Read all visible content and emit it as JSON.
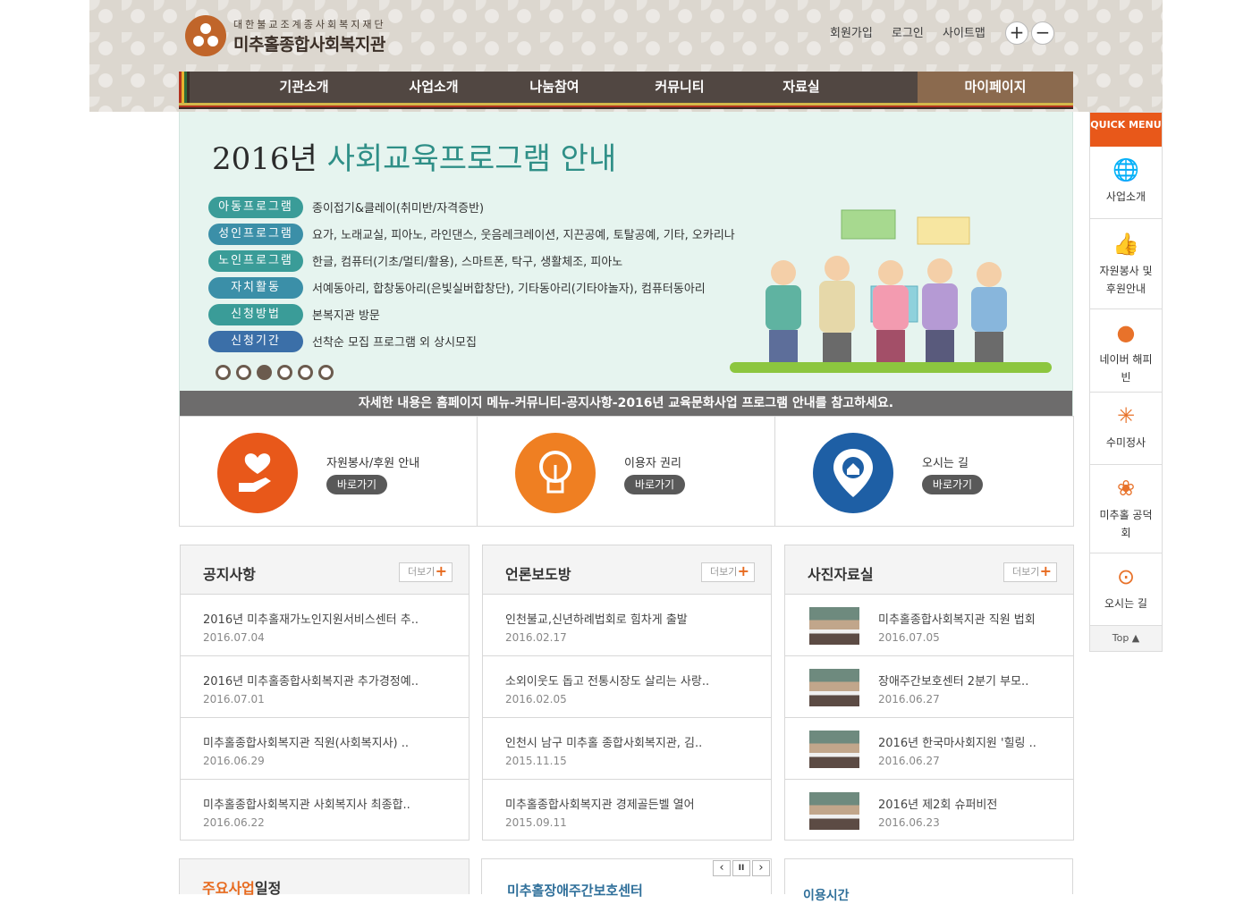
{
  "header": {
    "org_small": "대한불교조계종사회복지재단",
    "org_name": "미추홀종합사회복지관",
    "util": [
      "회원가입",
      "로그인",
      "사이트맵"
    ],
    "zoom_in": "+",
    "zoom_out": "−"
  },
  "nav": [
    "기관소개",
    "사업소개",
    "나눔참여",
    "커뮤니티",
    "자료실",
    "마이페이지"
  ],
  "banner": {
    "title_year": "2016년",
    "title_main": "사회교육프로그램 안내",
    "rows": [
      {
        "tag": "아동프로그램",
        "text": "종이접기&클레이(취미반/자격증반)",
        "color": "#3a9c98"
      },
      {
        "tag": "성인프로그램",
        "text": "요가, 노래교실, 피아노, 라인댄스, 웃음레크레이션, 지끈공예, 토탈공예, 기타, 오카리나",
        "color": "#3b8fa8"
      },
      {
        "tag": "노인프로그램",
        "text": "한글, 컴퓨터(기초/멀티/활용), 스마트폰, 탁구, 생활체조, 피아노",
        "color": "#3a9c98"
      },
      {
        "tag": "자치활동",
        "text": "서예동아리, 합창동아리(은빛실버합창단), 기타동아리(기타야놀자), 컴퓨터동아리",
        "color": "#3b8fa8"
      },
      {
        "tag": "신청방법",
        "text": "본복지관 방문",
        "color": "#3a9c98"
      },
      {
        "tag": "신청기간",
        "text": "선착순 모집 프로그램 외 상시모집",
        "color": "#3b6fa8"
      }
    ],
    "active_slide": 3,
    "slide_count": 6,
    "note": "자세한 내용은 홈페이지 메뉴-커뮤니티-공지사항-2016년 교육문화사업 프로그램 안내를 참고하세요."
  },
  "quick": [
    {
      "label": "자원봉사/후원 안내",
      "button": "바로가기",
      "color": "#e8581a",
      "icon": "heart-hand-icon"
    },
    {
      "label": "이용자 권리",
      "button": "바로가기",
      "color": "#ef7f22",
      "icon": "lightbulb-icon"
    },
    {
      "label": "오시는 길",
      "button": "바로가기",
      "color": "#1e5fa5",
      "icon": "map-pin-home-icon"
    }
  ],
  "boards": [
    {
      "title": "공지사항",
      "more": "더보기",
      "photo": false,
      "items": [
        {
          "title": "2016년 미추홀재가노인지원서비스센터 추..",
          "date": "2016.07.04"
        },
        {
          "title": "2016년 미추홀종합사회복지관 추가경정예..",
          "date": "2016.07.01"
        },
        {
          "title": "미추홀종합사회복지관 직원(사회복지사) ..",
          "date": "2016.06.29"
        },
        {
          "title": "미추홀종합사회복지관 사회복지사 최종합..",
          "date": "2016.06.22"
        }
      ]
    },
    {
      "title": "언론보도방",
      "more": "더보기",
      "photo": false,
      "items": [
        {
          "title": "인천불교,신년하례법회로 힘차게 출발",
          "date": "2016.02.17"
        },
        {
          "title": "소외이웃도 돕고 전통시장도 살리는 사랑..",
          "date": "2016.02.05"
        },
        {
          "title": "인천시 남구 미추홀 종합사회복지관, 김..",
          "date": "2015.11.15"
        },
        {
          "title": "미추홀종합사회복지관 경제골든벨 열어",
          "date": "2015.09.11"
        }
      ]
    },
    {
      "title": "사진자료실",
      "more": "더보기",
      "photo": true,
      "items": [
        {
          "title": "미추홀종합사회복지관 직원 법회",
          "date": "2016.07.05"
        },
        {
          "title": "장애주간보호센터 2분기 부모..",
          "date": "2016.06.27"
        },
        {
          "title": "2016년 한국마사회지원 '힐링 ..",
          "date": "2016.06.27"
        },
        {
          "title": "2016년 제2회 슈퍼비전",
          "date": "2016.06.23"
        }
      ]
    }
  ],
  "quickmenu": {
    "head": "QUICK MENU",
    "items": [
      {
        "label": "사업소개",
        "icon": "globe-icon",
        "glyph": "🌐"
      },
      {
        "label": "자원봉사 및 후원안내",
        "icon": "thumbs-up-icon",
        "glyph": "👍"
      },
      {
        "label": "네이버 해피빈",
        "icon": "bean-icon",
        "glyph": "●"
      },
      {
        "label": "수미정사",
        "icon": "temple-icon",
        "glyph": "✳"
      },
      {
        "label": "미추홀 공덕회",
        "icon": "lotus-icon",
        "glyph": "❀"
      },
      {
        "label": "오시는 길",
        "icon": "location-pin-icon",
        "glyph": "⊙"
      }
    ],
    "top": "Top ▲"
  },
  "bottom": {
    "schedule_a": "주요사업",
    "schedule_b": "일정",
    "center": "미추홀장애주간보호센터",
    "hours": "이용시간",
    "prev": "‹",
    "pause": "II",
    "next": "›"
  },
  "colors": {
    "accent": "#e8581a",
    "nav_bg": "#514742",
    "mypage_bg": "#8b6a4e",
    "banner_bg": "#e6f4ef"
  }
}
